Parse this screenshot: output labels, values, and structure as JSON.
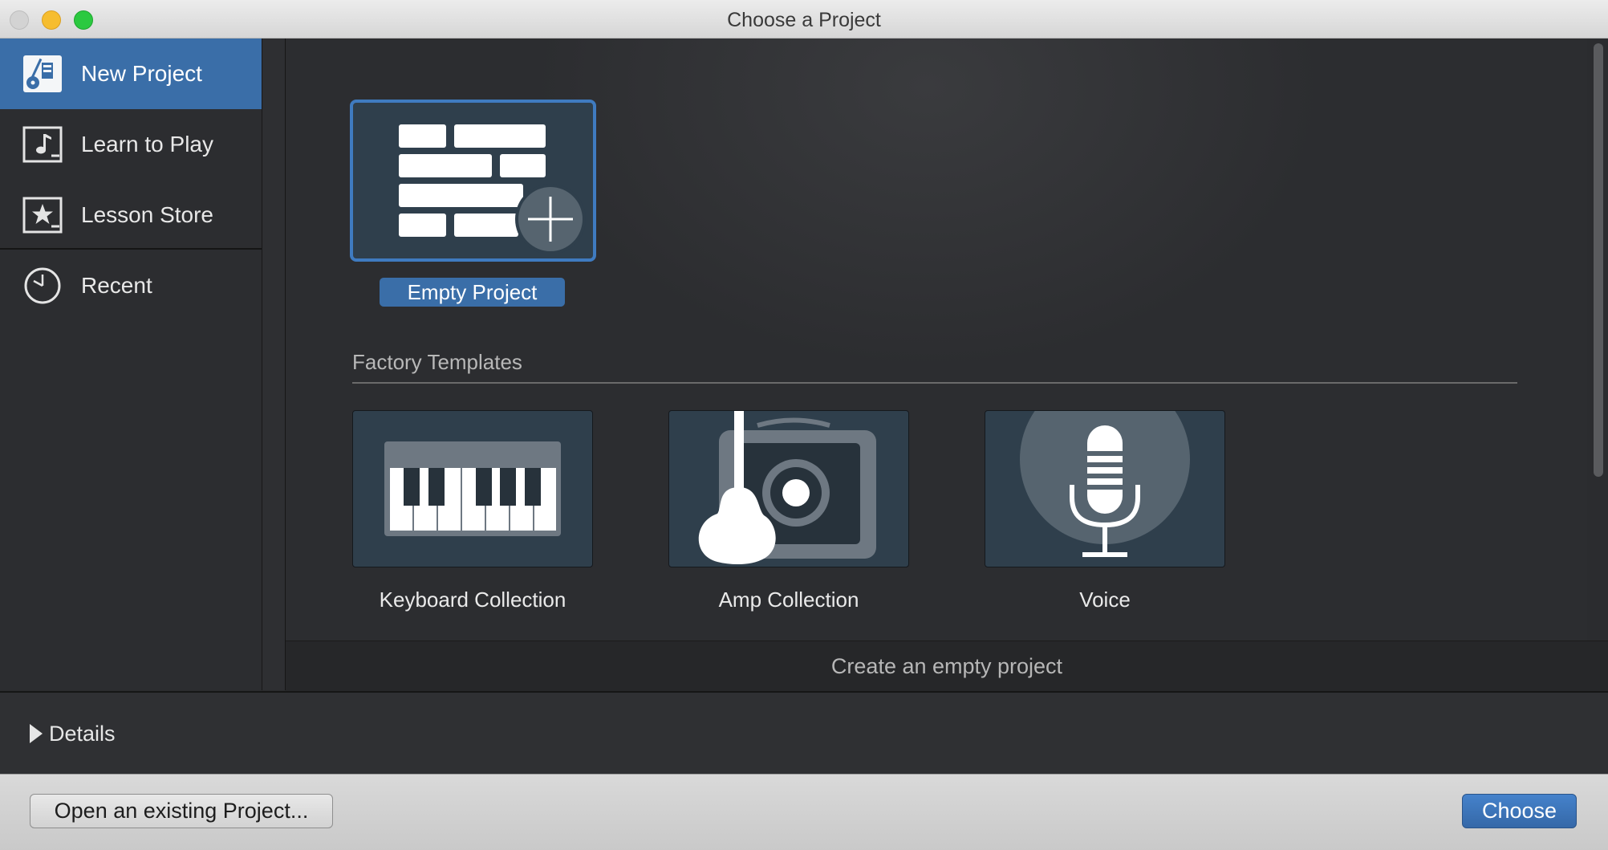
{
  "window": {
    "title": "Choose a Project"
  },
  "sidebar": {
    "items": [
      {
        "label": "New Project",
        "icon": "new-project-icon",
        "selected": true
      },
      {
        "label": "Learn to Play",
        "icon": "music-note-icon",
        "selected": false
      },
      {
        "label": "Lesson Store",
        "icon": "star-icon",
        "selected": false
      },
      {
        "label": "Recent",
        "icon": "clock-icon",
        "selected": false
      }
    ]
  },
  "main": {
    "empty_project": {
      "label": "Empty Project",
      "selected": true
    },
    "section_title": "Factory Templates",
    "templates": [
      {
        "label": "Keyboard Collection",
        "icon": "keyboard-icon"
      },
      {
        "label": "Amp Collection",
        "icon": "guitar-amp-icon"
      },
      {
        "label": "Voice",
        "icon": "microphone-icon"
      }
    ],
    "status_text": "Create an empty project"
  },
  "details": {
    "label": "Details"
  },
  "footer": {
    "open_label": "Open an existing Project...",
    "choose_label": "Choose"
  },
  "colors": {
    "accent": "#3a6ea8",
    "selection_border": "#3f7bc0",
    "card_background": "#2f3f4c"
  }
}
